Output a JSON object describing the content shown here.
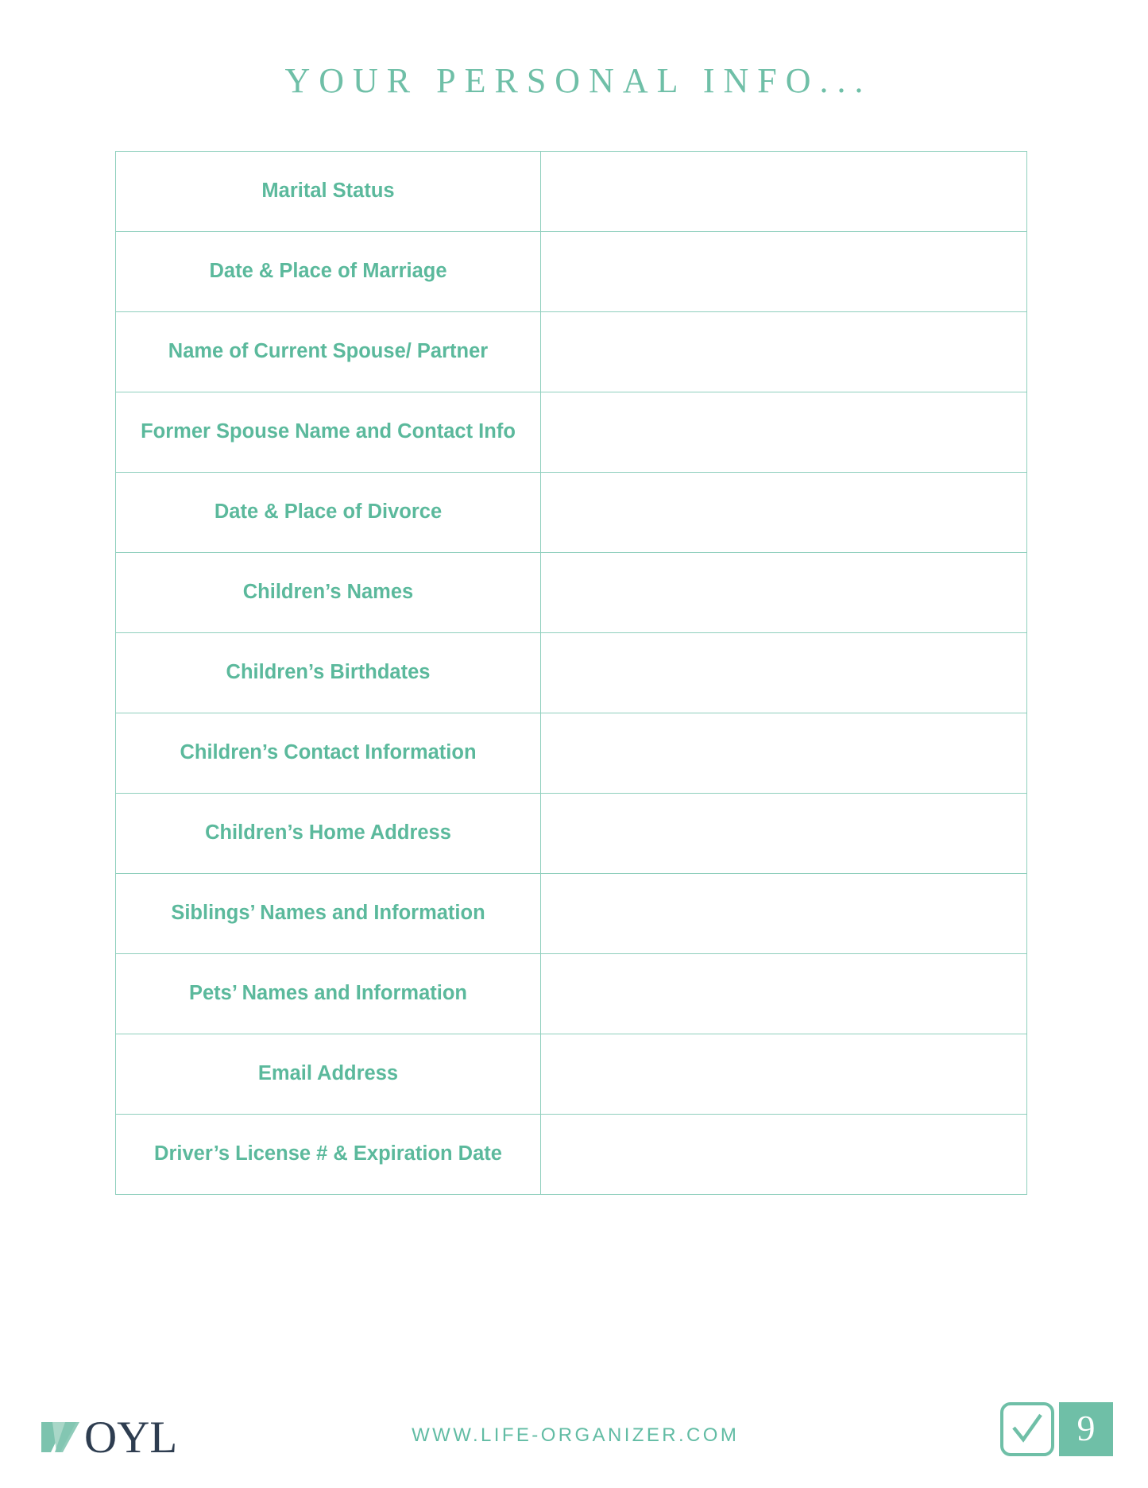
{
  "document": {
    "title": "YOUR PERSONAL INFO...",
    "accent_color": "#6fbfa7",
    "label_color": "#5bb99c",
    "border_color": "#8fcfbd",
    "logo_text_color": "#2e3d50"
  },
  "table": {
    "rows": [
      {
        "label": "Marital Status",
        "value": ""
      },
      {
        "label": "Date & Place of Marriage",
        "value": ""
      },
      {
        "label": "Name of Current Spouse/ Partner",
        "value": ""
      },
      {
        "label": "Former Spouse Name and Contact Info",
        "value": ""
      },
      {
        "label": "Date & Place of Divorce",
        "value": ""
      },
      {
        "label": "Children’s Names",
        "value": ""
      },
      {
        "label": "Children’s Birthdates",
        "value": ""
      },
      {
        "label": "Children’s Contact Information",
        "value": ""
      },
      {
        "label": "Children’s Home Address",
        "value": ""
      },
      {
        "label": "Siblings’ Names and Information",
        "value": ""
      },
      {
        "label": "Pets’ Names and Information",
        "value": ""
      },
      {
        "label": "Email Address",
        "value": ""
      },
      {
        "label": "Driver’s License # & Expiration Date",
        "value": ""
      }
    ]
  },
  "footer": {
    "logo_text": "OYL",
    "logo_mark_name": "oyl-chevron-mark",
    "url": "WWW.LIFE-ORGANIZER.COM",
    "checkbox_icon_name": "checkmark-box-icon",
    "page_number": "9"
  }
}
